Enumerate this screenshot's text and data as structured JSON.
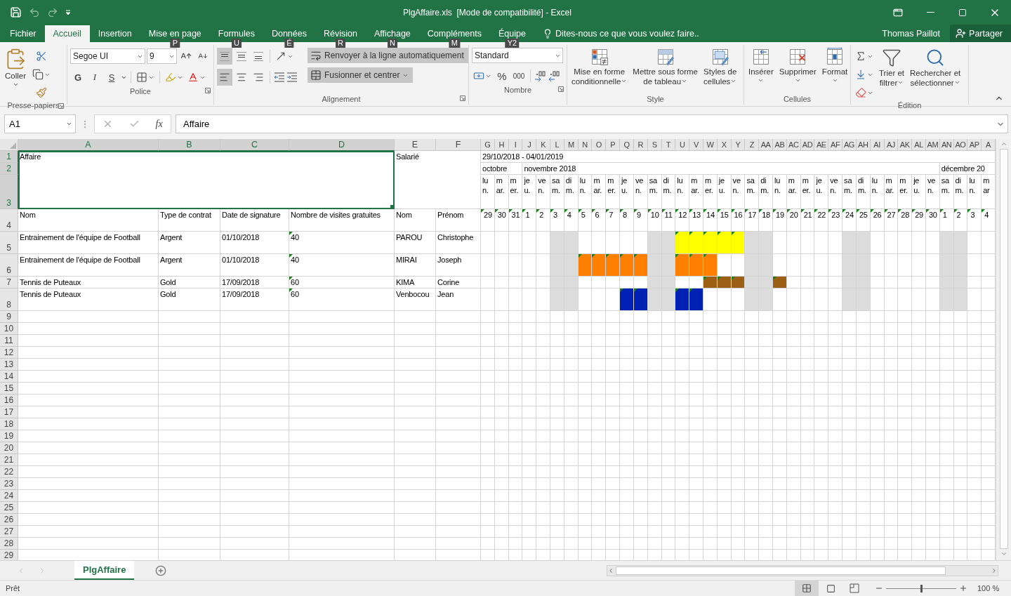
{
  "window": {
    "title": "PlgAffaire.xls  [Mode de compatibilité] - Excel"
  },
  "ribbon_tabs": [
    {
      "label": "Fichier",
      "selected": false
    },
    {
      "label": "Accueil",
      "selected": true
    },
    {
      "label": "Insertion",
      "selected": false
    },
    {
      "label": "Mise en page",
      "selected": false,
      "keytip": "P"
    },
    {
      "label": "Formules",
      "selected": false,
      "keytip": "U"
    },
    {
      "label": "Données",
      "selected": false,
      "keytip": "É"
    },
    {
      "label": "Révision",
      "selected": false,
      "keytip": "R"
    },
    {
      "label": "Affichage",
      "selected": false,
      "keytip": "N"
    },
    {
      "label": "Compléments",
      "selected": false,
      "keytip": "M"
    },
    {
      "label": "Équipe",
      "selected": false,
      "keytip": "Y2"
    }
  ],
  "tell_me": {
    "placeholder": "Dites-nous ce que vous voulez faire.."
  },
  "user": "Thomas Paillot",
  "share_button": "Partager",
  "ribbon_groups": [
    {
      "kind": "clipboard",
      "label": "Presse-papiers",
      "launcher": true,
      "paste": "Coller"
    },
    {
      "kind": "font",
      "label": "Police",
      "launcher": true,
      "font": "Segoe UI",
      "size": "9",
      "bold": "G",
      "italic": "I",
      "underline": "S"
    },
    {
      "kind": "alignment",
      "label": "Alignement",
      "launcher": true,
      "valign": [
        {
          "selected": true
        },
        {
          "selected": false
        },
        {
          "selected": false
        }
      ],
      "halign": [
        {
          "selected": true
        },
        {
          "selected": false
        },
        {
          "selected": false
        }
      ],
      "wrap": {
        "label": "Renvoyer à la ligne automatiquement",
        "selected": true
      },
      "merge": {
        "label": "Fusionner et centrer",
        "selected": true
      }
    },
    {
      "kind": "number",
      "label": "Nombre",
      "launcher": true,
      "format": "Standard",
      "percent": "%",
      "thousands": "000"
    },
    {
      "kind": "style",
      "label": "Style",
      "launcher": false,
      "buttons": [
        "Mise en forme\nconditionnelle",
        "Mettre sous forme\nde tableau",
        "Styles de\ncellules"
      ]
    },
    {
      "kind": "cells",
      "label": "Cellules",
      "launcher": false,
      "buttons": [
        "Insérer",
        "Supprimer",
        "Format"
      ]
    },
    {
      "kind": "editing",
      "label": "Édition",
      "launcher": false,
      "buttons": [
        "Trier et\nfiltrer",
        "Rechercher et\nsélectionner"
      ]
    }
  ],
  "formula_bar": {
    "name_box": "A1",
    "fx": "fx",
    "value": "Affaire"
  },
  "sheet": {
    "columns": [
      {
        "label": "A",
        "selected": true
      },
      {
        "label": "B",
        "selected": true
      },
      {
        "label": "C",
        "selected": true
      },
      {
        "label": "D",
        "selected": true
      },
      {
        "label": "E",
        "selected": false
      },
      {
        "label": "F",
        "selected": false
      }
    ],
    "row_headers": [
      {
        "label": "1",
        "selected": true
      },
      {
        "label": "2",
        "selected": true
      },
      {
        "label": "3",
        "selected": true
      },
      {
        "label": "4",
        "selected": false
      },
      {
        "label": "5",
        "selected": false
      },
      {
        "label": "6",
        "selected": false
      },
      {
        "label": "7",
        "selected": false
      },
      {
        "label": "8",
        "selected": false
      },
      {
        "label": "9",
        "selected": false
      },
      {
        "label": "10",
        "selected": false
      },
      {
        "label": "11",
        "selected": false
      },
      {
        "label": "12",
        "selected": false
      },
      {
        "label": "13",
        "selected": false
      },
      {
        "label": "14",
        "selected": false
      },
      {
        "label": "15",
        "selected": false
      },
      {
        "label": "16",
        "selected": false
      },
      {
        "label": "17",
        "selected": false
      },
      {
        "label": "18",
        "selected": false
      },
      {
        "label": "19",
        "selected": false
      },
      {
        "label": "20",
        "selected": false
      },
      {
        "label": "21",
        "selected": false
      },
      {
        "label": "22",
        "selected": false
      },
      {
        "label": "23",
        "selected": false
      },
      {
        "label": "24",
        "selected": false
      },
      {
        "label": "25",
        "selected": false
      },
      {
        "label": "26",
        "selected": false
      },
      {
        "label": "27",
        "selected": false
      },
      {
        "label": "28",
        "selected": false
      },
      {
        "label": "29",
        "selected": false
      }
    ],
    "title_cells": [
      "Affaire",
      "Salarié"
    ],
    "headers": [
      "Nom",
      "Type de contrat",
      "Date de signature",
      "Nombre de visites gratuites",
      "Nom",
      "Prénom"
    ],
    "calendar": {
      "range": "29/10/2018 - 04/01/2019",
      "months": [
        "octobre",
        "novembre 2018",
        "décembre 20"
      ],
      "days": [
        {
          "column": "G",
          "weekday": "lu\nn.",
          "date": "29",
          "weekend": false,
          "month_start": true
        },
        {
          "column": "H",
          "weekday": "m\nar.",
          "date": "30",
          "weekend": false,
          "month_start": false
        },
        {
          "column": "I",
          "weekday": "m\ner.",
          "date": "31",
          "weekend": false,
          "month_start": false
        },
        {
          "column": "J",
          "weekday": "je\nu.",
          "date": "1",
          "weekend": false,
          "month_start": true
        },
        {
          "column": "K",
          "weekday": "ve\nn.",
          "date": "2",
          "weekend": false,
          "month_start": false
        },
        {
          "column": "L",
          "weekday": "sa\nm.",
          "date": "3",
          "weekend": true,
          "month_start": false
        },
        {
          "column": "M",
          "weekday": "di\nm.",
          "date": "4",
          "weekend": true,
          "month_start": false
        },
        {
          "column": "N",
          "weekday": "lu\nn.",
          "date": "5",
          "weekend": false,
          "month_start": false
        },
        {
          "column": "O",
          "weekday": "m\nar.",
          "date": "6",
          "weekend": false,
          "month_start": false
        },
        {
          "column": "P",
          "weekday": "m\ner.",
          "date": "7",
          "weekend": false,
          "month_start": false
        },
        {
          "column": "Q",
          "weekday": "je\nu.",
          "date": "8",
          "weekend": false,
          "month_start": false
        },
        {
          "column": "R",
          "weekday": "ve\nn.",
          "date": "9",
          "weekend": false,
          "month_start": false
        },
        {
          "column": "S",
          "weekday": "sa\nm.",
          "date": "10",
          "weekend": true,
          "month_start": false
        },
        {
          "column": "T",
          "weekday": "di\nm.",
          "date": "11",
          "weekend": true,
          "month_start": false
        },
        {
          "column": "U",
          "weekday": "lu\nn.",
          "date": "12",
          "weekend": false,
          "month_start": false
        },
        {
          "column": "V",
          "weekday": "m\nar.",
          "date": "13",
          "weekend": false,
          "month_start": false
        },
        {
          "column": "W",
          "weekday": "m\ner.",
          "date": "14",
          "weekend": false,
          "month_start": false
        },
        {
          "column": "X",
          "weekday": "je\nu.",
          "date": "15",
          "weekend": false,
          "month_start": false
        },
        {
          "column": "Y",
          "weekday": "ve\nn.",
          "date": "16",
          "weekend": false,
          "month_start": false
        },
        {
          "column": "Z",
          "weekday": "sa\nm.",
          "date": "17",
          "weekend": true,
          "month_start": false
        },
        {
          "column": "AA",
          "weekday": "di\nm.",
          "date": "18",
          "weekend": true,
          "month_start": false
        },
        {
          "column": "AB",
          "weekday": "lu\nn.",
          "date": "19",
          "weekend": false,
          "month_start": false
        },
        {
          "column": "AC",
          "weekday": "m\nar.",
          "date": "20",
          "weekend": false,
          "month_start": false
        },
        {
          "column": "AD",
          "weekday": "m\ner.",
          "date": "21",
          "weekend": false,
          "month_start": false
        },
        {
          "column": "AE",
          "weekday": "je\nu.",
          "date": "22",
          "weekend": false,
          "month_start": false
        },
        {
          "column": "AF",
          "weekday": "ve\nn.",
          "date": "23",
          "weekend": false,
          "month_start": false
        },
        {
          "column": "AG",
          "weekday": "sa\nm.",
          "date": "24",
          "weekend": true,
          "month_start": false
        },
        {
          "column": "AH",
          "weekday": "di\nm.",
          "date": "25",
          "weekend": true,
          "month_start": false
        },
        {
          "column": "AI",
          "weekday": "lu\nn.",
          "date": "26",
          "weekend": false,
          "month_start": false
        },
        {
          "column": "AJ",
          "weekday": "m\nar.",
          "date": "27",
          "weekend": false,
          "month_start": false
        },
        {
          "column": "AK",
          "weekday": "m\ner.",
          "date": "28",
          "weekend": false,
          "month_start": false
        },
        {
          "column": "AL",
          "weekday": "je\nu.",
          "date": "29",
          "weekend": false,
          "month_start": false
        },
        {
          "column": "AM",
          "weekday": "ve\nn.",
          "date": "30",
          "weekend": false,
          "month_start": false
        },
        {
          "column": "AN",
          "weekday": "sa\nm.",
          "date": "1",
          "weekend": true,
          "month_start": true
        },
        {
          "column": "AO",
          "weekday": "di\nm.",
          "date": "2",
          "weekend": true,
          "month_start": false
        },
        {
          "column": "AP",
          "weekday": "lu\nn.",
          "date": "3",
          "weekend": false,
          "month_start": false
        },
        {
          "column": "A",
          "weekday": "m\nar",
          "date": "4",
          "weekend": false,
          "month_start": false
        }
      ]
    },
    "rows": [
      {
        "affaire": "Entrainement de l'équipe de Football",
        "contrat": "Argent",
        "date": "01/10/2018",
        "visites": "40",
        "nom": "PAROU",
        "prenom": "Christophe",
        "cells": [
          {
            "booked": false
          },
          {
            "booked": false
          },
          {
            "booked": false
          },
          {
            "booked": false
          },
          {
            "booked": false
          },
          {
            "booked": false
          },
          {
            "booked": false
          },
          {
            "booked": false
          },
          {
            "booked": false
          },
          {
            "booked": false
          },
          {
            "booked": false
          },
          {
            "booked": false
          },
          {
            "booked": false
          },
          {
            "booked": false
          },
          {
            "booked": true,
            "color": "#ffff00"
          },
          {
            "booked": true,
            "color": "#ffff00"
          },
          {
            "booked": true,
            "color": "#ffff00"
          },
          {
            "booked": true,
            "color": "#ffff00"
          },
          {
            "booked": true,
            "color": "#ffff00"
          },
          {
            "booked": false
          },
          {
            "booked": false
          },
          {
            "booked": false
          },
          {
            "booked": false
          },
          {
            "booked": false
          },
          {
            "booked": false
          },
          {
            "booked": false
          },
          {
            "booked": false
          },
          {
            "booked": false
          },
          {
            "booked": false
          },
          {
            "booked": false
          },
          {
            "booked": false
          },
          {
            "booked": false
          },
          {
            "booked": false
          },
          {
            "booked": false
          },
          {
            "booked": false
          },
          {
            "booked": false
          },
          {
            "booked": false
          }
        ]
      },
      {
        "affaire": "Entrainement de l'équipe de Football",
        "contrat": "Argent",
        "date": "01/10/2018",
        "visites": "40",
        "nom": "MIRAI",
        "prenom": "Joseph",
        "cells": [
          {
            "booked": false
          },
          {
            "booked": false
          },
          {
            "booked": false
          },
          {
            "booked": false
          },
          {
            "booked": false
          },
          {
            "booked": false
          },
          {
            "booked": false
          },
          {
            "booked": true,
            "color": "#ff8000"
          },
          {
            "booked": true,
            "color": "#ff8000"
          },
          {
            "booked": true,
            "color": "#ff8000"
          },
          {
            "booked": true,
            "color": "#ff8000"
          },
          {
            "booked": true,
            "color": "#ff8000"
          },
          {
            "booked": false
          },
          {
            "booked": false
          },
          {
            "booked": true,
            "color": "#ff8000"
          },
          {
            "booked": true,
            "color": "#ff8000"
          },
          {
            "booked": true,
            "color": "#ff8000"
          },
          {
            "booked": false
          },
          {
            "booked": false
          },
          {
            "booked": false
          },
          {
            "booked": false
          },
          {
            "booked": false
          },
          {
            "booked": false
          },
          {
            "booked": false
          },
          {
            "booked": false
          },
          {
            "booked": false
          },
          {
            "booked": false
          },
          {
            "booked": false
          },
          {
            "booked": false
          },
          {
            "booked": false
          },
          {
            "booked": false
          },
          {
            "booked": false
          },
          {
            "booked": false
          },
          {
            "booked": false
          },
          {
            "booked": false
          },
          {
            "booked": false
          },
          {
            "booked": false
          }
        ]
      },
      {
        "affaire": "Tennis de Puteaux",
        "contrat": "Gold",
        "date": "17/09/2018",
        "visites": "60",
        "nom": "KIMA",
        "prenom": "Corine",
        "cells": [
          {
            "booked": false
          },
          {
            "booked": false
          },
          {
            "booked": false
          },
          {
            "booked": false
          },
          {
            "booked": false
          },
          {
            "booked": false
          },
          {
            "booked": false
          },
          {
            "booked": false
          },
          {
            "booked": false
          },
          {
            "booked": false
          },
          {
            "booked": false
          },
          {
            "booked": false
          },
          {
            "booked": false
          },
          {
            "booked": false
          },
          {
            "booked": false
          },
          {
            "booked": false
          },
          {
            "booked": true,
            "color": "#9c6014"
          },
          {
            "booked": true,
            "color": "#9c6014"
          },
          {
            "booked": true,
            "color": "#9c6014"
          },
          {
            "booked": false
          },
          {
            "booked": false
          },
          {
            "booked": true,
            "color": "#9c6014"
          },
          {
            "booked": false
          },
          {
            "booked": false
          },
          {
            "booked": false
          },
          {
            "booked": false
          },
          {
            "booked": false
          },
          {
            "booked": false
          },
          {
            "booked": false
          },
          {
            "booked": false
          },
          {
            "booked": false
          },
          {
            "booked": false
          },
          {
            "booked": false
          },
          {
            "booked": false
          },
          {
            "booked": false
          },
          {
            "booked": false
          },
          {
            "booked": false
          }
        ]
      },
      {
        "affaire": "Tennis de Puteaux",
        "contrat": "Gold",
        "date": "17/09/2018",
        "visites": "60",
        "nom": "Venbocou",
        "prenom": "Jean",
        "cells": [
          {
            "booked": false
          },
          {
            "booked": false
          },
          {
            "booked": false
          },
          {
            "booked": false
          },
          {
            "booked": false
          },
          {
            "booked": false
          },
          {
            "booked": false
          },
          {
            "booked": false
          },
          {
            "booked": false
          },
          {
            "booked": false
          },
          {
            "booked": true,
            "color": "#0022b4"
          },
          {
            "booked": true,
            "color": "#0022b4"
          },
          {
            "booked": false
          },
          {
            "booked": false
          },
          {
            "booked": true,
            "color": "#0022b4"
          },
          {
            "booked": true,
            "color": "#0022b4"
          },
          {
            "booked": false
          },
          {
            "booked": false
          },
          {
            "booked": false
          },
          {
            "booked": false
          },
          {
            "booked": false
          },
          {
            "booked": false
          },
          {
            "booked": false
          },
          {
            "booked": false
          },
          {
            "booked": false
          },
          {
            "booked": false
          },
          {
            "booked": false
          },
          {
            "booked": false
          },
          {
            "booked": false
          },
          {
            "booked": false
          },
          {
            "booked": false
          },
          {
            "booked": false
          },
          {
            "booked": false
          },
          {
            "booked": false
          },
          {
            "booked": false
          },
          {
            "booked": false
          },
          {
            "booked": false
          }
        ]
      }
    ]
  },
  "sheet_tabs": [
    {
      "label": "PlgAffaire",
      "selected": true
    }
  ],
  "status_bar": {
    "status": "Prêt",
    "views": [
      {
        "selected": true
      },
      {
        "selected": false
      },
      {
        "selected": false
      }
    ],
    "zoom": {
      "level": 0.5
    },
    "zoom_label": "100 %"
  }
}
